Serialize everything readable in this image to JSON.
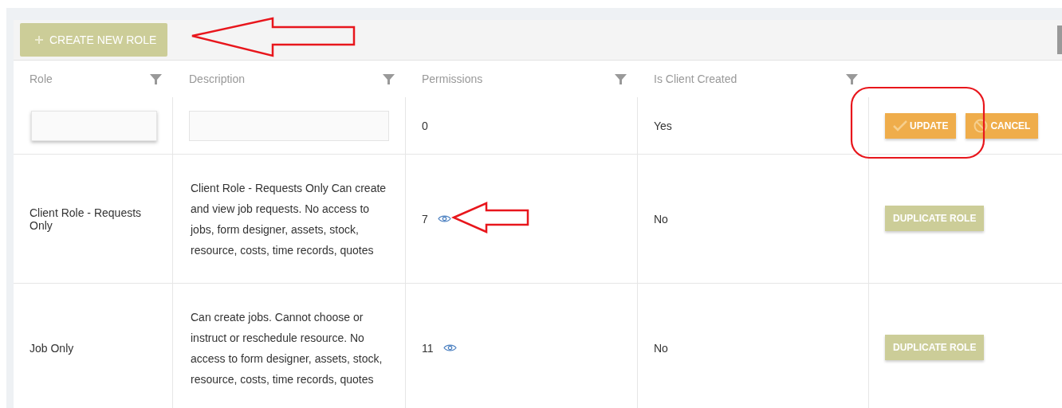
{
  "toolbar": {
    "create_button": "CREATE NEW ROLE"
  },
  "table": {
    "columns": [
      {
        "label": "Role",
        "filter": true
      },
      {
        "label": "Description",
        "filter": true
      },
      {
        "label": "Permissions",
        "filter": true
      },
      {
        "label": "Is Client Created",
        "filter": true
      }
    ],
    "edit_row": {
      "permissions": "0",
      "client_created": "Yes",
      "update_button": "UPDATE",
      "cancel_button": "CANCEL"
    },
    "rows": [
      {
        "role": "Client Role - Requests Only",
        "description": "Client Role - Requests Only Can create and view job requests. No access to jobs, form designer, assets, stock, resource, costs, time records, quotes",
        "permissions": "7",
        "client_created": "No",
        "action": "DUPLICATE ROLE"
      },
      {
        "role": "Job Only",
        "description": "Can create jobs. Cannot choose or instruct or reschedule resource. No access to form designer, assets, stock, resource, costs, time records, quotes",
        "permissions": "11",
        "client_created": "No",
        "action": "DUPLICATE ROLE"
      }
    ]
  }
}
